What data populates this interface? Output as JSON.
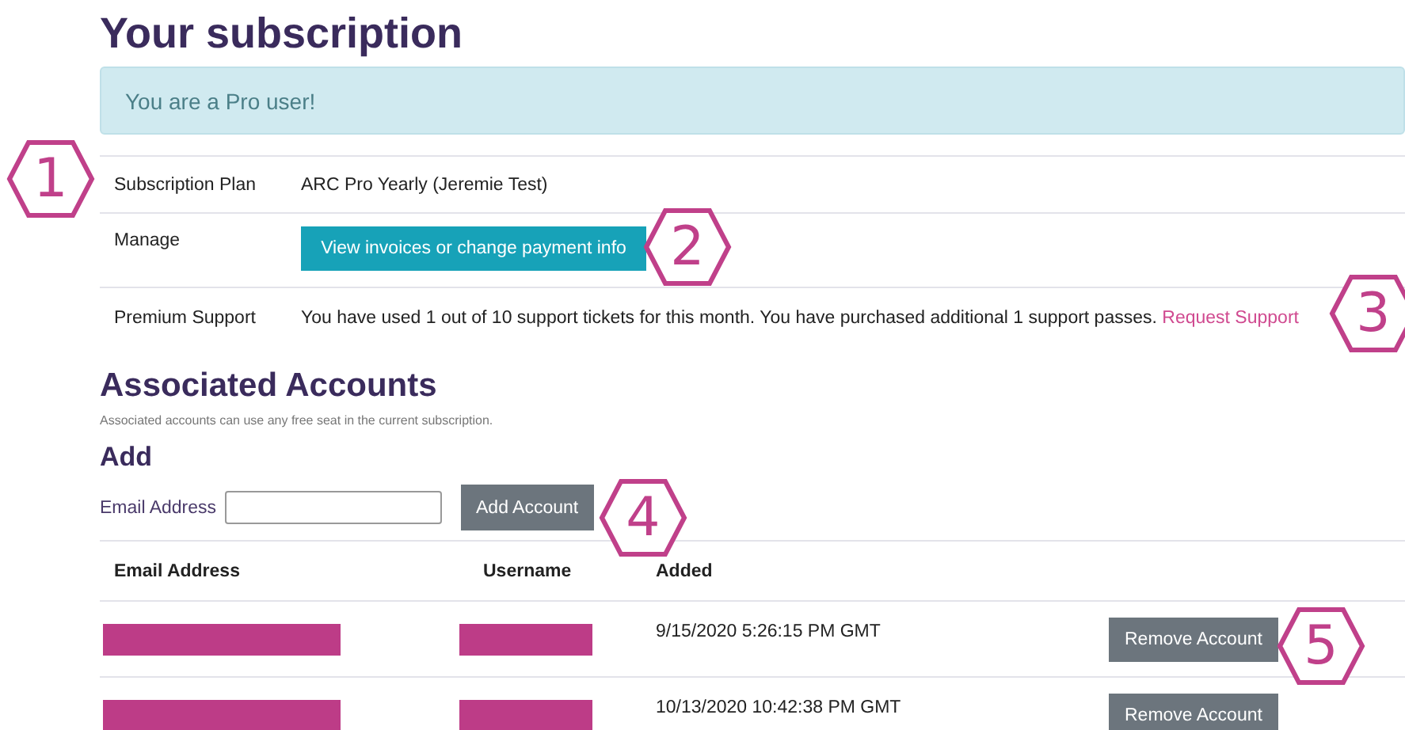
{
  "subscription": {
    "title": "Your subscription",
    "alert": "You are a Pro user!",
    "rows": [
      {
        "kind": "text",
        "label": "Subscription Plan",
        "value": "ARC Pro Yearly (Jeremie Test)"
      },
      {
        "kind": "button",
        "label": "Manage",
        "value": "View invoices or change payment info"
      },
      {
        "kind": "support",
        "label": "Premium Support",
        "value": "You have used 1 out of 10 support tickets for this month. You have purchased additional 1 support passes.",
        "link": "Request Support"
      }
    ]
  },
  "associated": {
    "title": "Associated Accounts",
    "note": "Associated accounts can use any free seat in the current subscription.",
    "add_title": "Add",
    "email_label": "Email Address",
    "add_button": "Add Account",
    "columns": [
      "Email Address",
      "Username",
      "Added"
    ],
    "rows": [
      {
        "added": "9/15/2020 5:26:15 PM GMT",
        "action": "Remove Account"
      },
      {
        "added": "10/13/2020 10:42:38 PM GMT",
        "action": "Remove Account"
      }
    ]
  },
  "callouts": [
    {
      "label": "1"
    },
    {
      "label": "2"
    },
    {
      "label": "3"
    },
    {
      "label": "4"
    },
    {
      "label": "5"
    }
  ]
}
